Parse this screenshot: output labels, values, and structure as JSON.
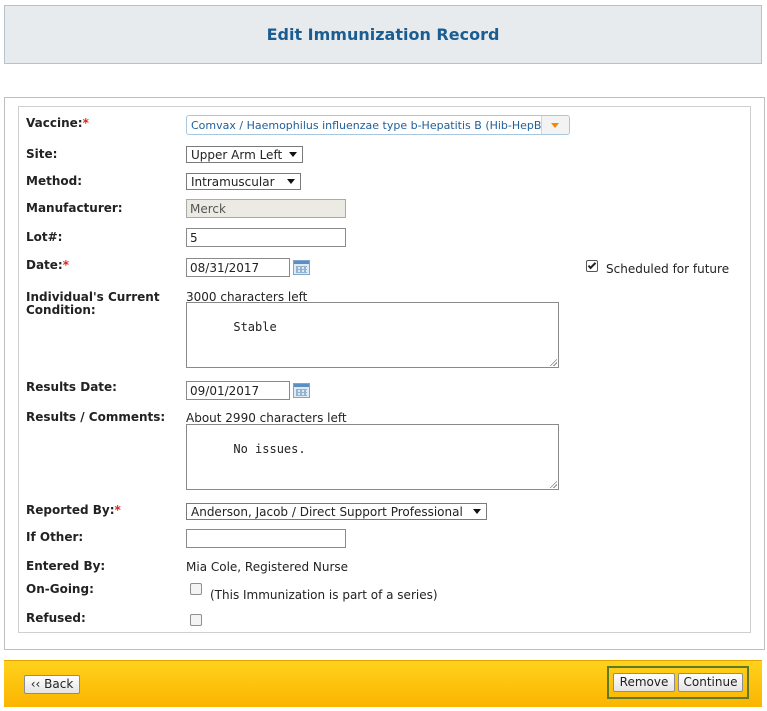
{
  "header": {
    "title": "Edit Immunization Record"
  },
  "form": {
    "vaccine": {
      "label": "Vaccine:",
      "required_mark": "*",
      "value": "Comvax / Haemophilus influenzae type b-Hepatitis B (Hib-HepB)"
    },
    "site": {
      "label": "Site:",
      "value": "Upper Arm Left"
    },
    "method": {
      "label": "Method:",
      "value": "Intramuscular"
    },
    "manufacturer": {
      "label": "Manufacturer:",
      "value": "Merck"
    },
    "lot": {
      "label": "Lot#:",
      "value": "5"
    },
    "date": {
      "label": "Date:",
      "required_mark": "*",
      "value": "08/31/2017"
    },
    "scheduled": {
      "label": "Scheduled for future",
      "checked": true
    },
    "condition": {
      "label_line1": "Individual's Current",
      "label_line2": "Condition:",
      "counter": "3000 characters left",
      "value": "Stable"
    },
    "results_date": {
      "label": "Results Date:",
      "value": "09/01/2017"
    },
    "results_comments": {
      "label": "Results / Comments:",
      "counter": "About 2990 characters left",
      "value": "No issues."
    },
    "reported_by": {
      "label": "Reported By:",
      "required_mark": "*",
      "value": "Anderson, Jacob / Direct Support Professional"
    },
    "if_other": {
      "label": "If Other:",
      "value": ""
    },
    "entered_by": {
      "label": "Entered By:",
      "value": "Mia Cole, Registered Nurse"
    },
    "ongoing": {
      "label": "On-Going:",
      "checkbox_text": "(This Immunization is part of a series)",
      "checked": false
    },
    "refused": {
      "label": "Refused:",
      "checked": false
    }
  },
  "footer": {
    "back_label": "‹‹ Back",
    "remove_label": "Remove",
    "continue_label": "Continue"
  },
  "colors": {
    "header_title": "#1b5d90",
    "required": "#d9261c",
    "footer_bar": "#fbb400",
    "accent_arrow": "#f28a00"
  }
}
